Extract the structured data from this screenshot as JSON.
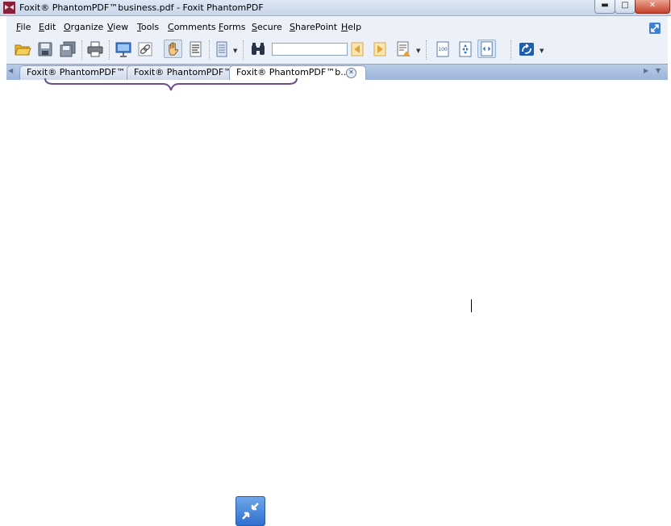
{
  "window": {
    "title": "Foxit® PhantomPDF™business.pdf - Foxit PhantomPDF",
    "buttons": {
      "minimize": "▬",
      "maximize": "□",
      "close": "✕"
    }
  },
  "menu": {
    "items": [
      {
        "label": "File",
        "mnemonic": "F",
        "rest": "ile"
      },
      {
        "label": "Edit",
        "mnemonic": "E",
        "rest": "dit"
      },
      {
        "label": "Organize",
        "mnemonic": "O",
        "rest": "rganize"
      },
      {
        "label": "View",
        "mnemonic": "V",
        "rest": "iew"
      },
      {
        "label": "Tools",
        "mnemonic": "T",
        "rest": "ools"
      },
      {
        "label": "Comments",
        "mnemonic": "C",
        "rest": "omments"
      },
      {
        "label": "Forms",
        "mnemonic": "F",
        "rest": "orms"
      },
      {
        "label": "Secure",
        "mnemonic": "S",
        "rest": "ecure"
      },
      {
        "label": "SharePoint",
        "mnemonic": "S",
        "rest": "harePoint"
      },
      {
        "label": "Help",
        "mnemonic": "H",
        "rest": "elp"
      }
    ]
  },
  "toolbar": {
    "icons": [
      "open-folder-icon",
      "save-icon",
      "save-all-icon",
      "print-icon",
      "presentation-icon",
      "link-icon",
      "hand-tool-icon",
      "select-text-icon",
      "page-layout-icon",
      "find-icon",
      "previous-result-icon",
      "next-result-icon",
      "search-options-icon",
      "actual-size-icon",
      "fit-page-icon",
      "fit-width-icon",
      "sharepoint-icon"
    ],
    "search": {
      "value": "",
      "placeholder": ""
    }
  },
  "tabs": [
    {
      "label": "Foxit® PhantomPDF™ ...",
      "active": false
    },
    {
      "label": "Foxit® PhantomPDF™ ...",
      "active": false
    },
    {
      "label": "Foxit® PhantomPDF™b...",
      "active": true
    }
  ],
  "colors": {
    "chrome": "#ecf1f9",
    "tabbar": "#9cb4dc",
    "accent": "#2f6fcf"
  }
}
